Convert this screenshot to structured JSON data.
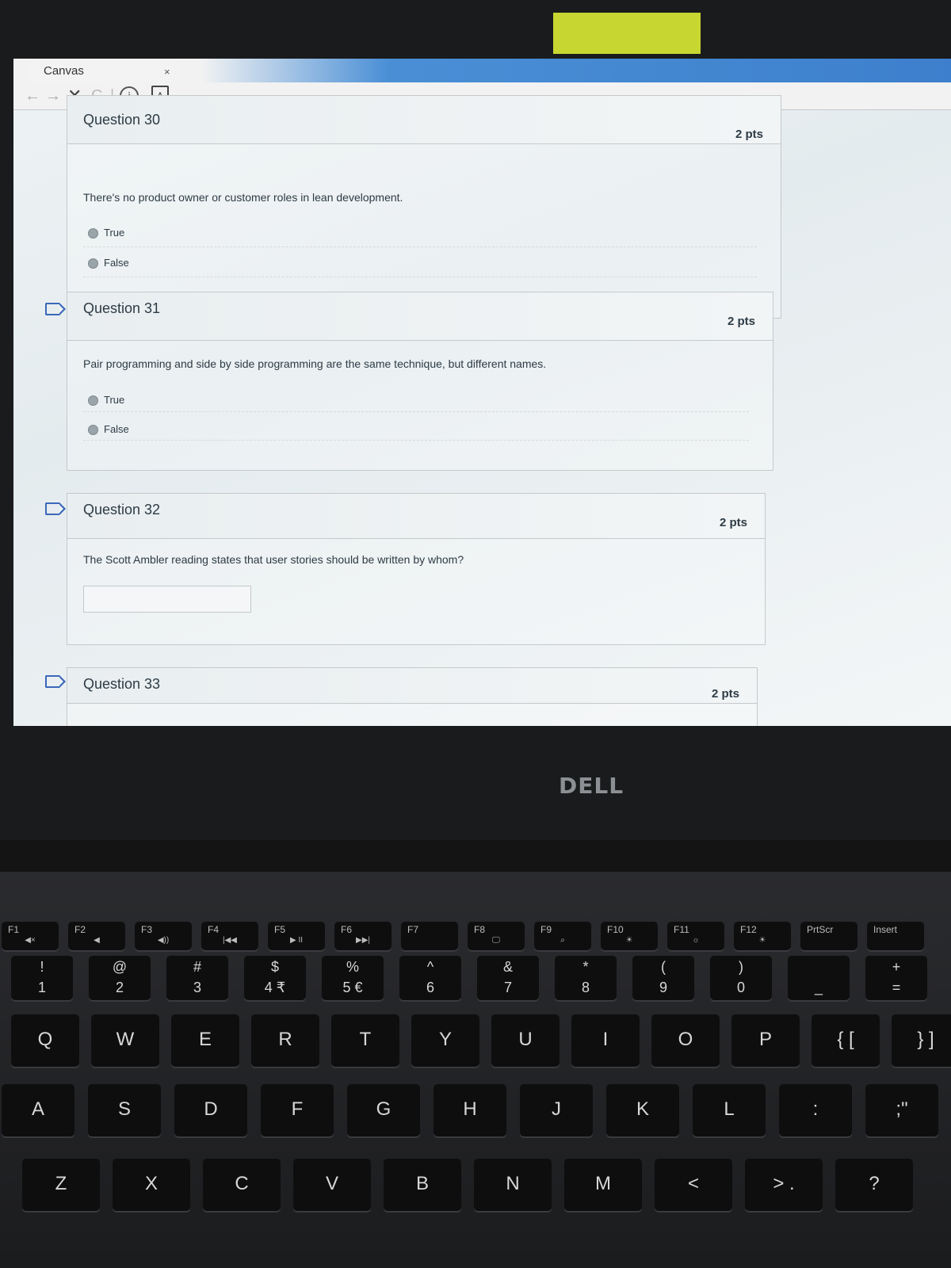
{
  "browser": {
    "tab_title": "Canvas",
    "tab_close": "×",
    "nav": {
      "back": "←",
      "forward": "→",
      "stop": "✕",
      "reload": "C",
      "separator": "|",
      "info": "i",
      "pdf": "A"
    }
  },
  "quiz": {
    "q30": {
      "title": "Question 30",
      "points": "2 pts",
      "text": "There's no product owner or customer roles in lean development.",
      "options": [
        "True",
        "False"
      ]
    },
    "q31": {
      "title": "Question 31",
      "points": "2 pts",
      "text": "Pair programming and side by side programming are the same technique, but different names.",
      "options": [
        "True",
        "False"
      ]
    },
    "q32": {
      "title": "Question 32",
      "points": "2 pts",
      "text": "The Scott Ambler reading states that user stories should be written by whom?",
      "answer_value": ""
    },
    "q33": {
      "title": "Question 33",
      "points": "2 pts"
    }
  },
  "laptop": {
    "brand": "DELL",
    "fkeys": [
      {
        "label": "F1",
        "icon": "◀×"
      },
      {
        "label": "F2",
        "icon": "◀"
      },
      {
        "label": "F3",
        "icon": "◀))"
      },
      {
        "label": "F4",
        "icon": "|◀◀"
      },
      {
        "label": "F5",
        "icon": "▶ II"
      },
      {
        "label": "F6",
        "icon": "▶▶|"
      },
      {
        "label": "F7",
        "icon": ""
      },
      {
        "label": "F8",
        "icon": "🖵"
      },
      {
        "label": "F9",
        "icon": "⌕"
      },
      {
        "label": "F10",
        "icon": "☀"
      },
      {
        "label": "F11",
        "icon": "☼"
      },
      {
        "label": "F12",
        "icon": "☀"
      },
      {
        "label": "PrtScr",
        "icon": ""
      },
      {
        "label": "Insert",
        "icon": ""
      }
    ],
    "number_row": [
      {
        "top": "!",
        "main": "1"
      },
      {
        "top": "@",
        "main": "2"
      },
      {
        "top": "#",
        "main": "3"
      },
      {
        "top": "$",
        "main": "4 ₹"
      },
      {
        "top": "%",
        "main": "5 €"
      },
      {
        "top": "^",
        "main": "6"
      },
      {
        "top": "&",
        "main": "7"
      },
      {
        "top": "*",
        "main": "8"
      },
      {
        "top": "(",
        "main": "9"
      },
      {
        "top": ")",
        "main": "0"
      },
      {
        "top": "",
        "main": "_"
      },
      {
        "top": "+",
        "main": "="
      }
    ],
    "qwerty_row": [
      "Q",
      "W",
      "E",
      "R",
      "T",
      "Y",
      "U",
      "I",
      "O",
      "P",
      "{ [",
      "} ]"
    ],
    "home_row": [
      "A",
      "S",
      "D",
      "F",
      "G",
      "H",
      "J",
      "K",
      "L",
      ":",
      ";\""
    ],
    "bottom_row": [
      "Z",
      "X",
      "C",
      "V",
      "B",
      "N",
      "M",
      "<",
      "> .",
      "?"
    ]
  }
}
